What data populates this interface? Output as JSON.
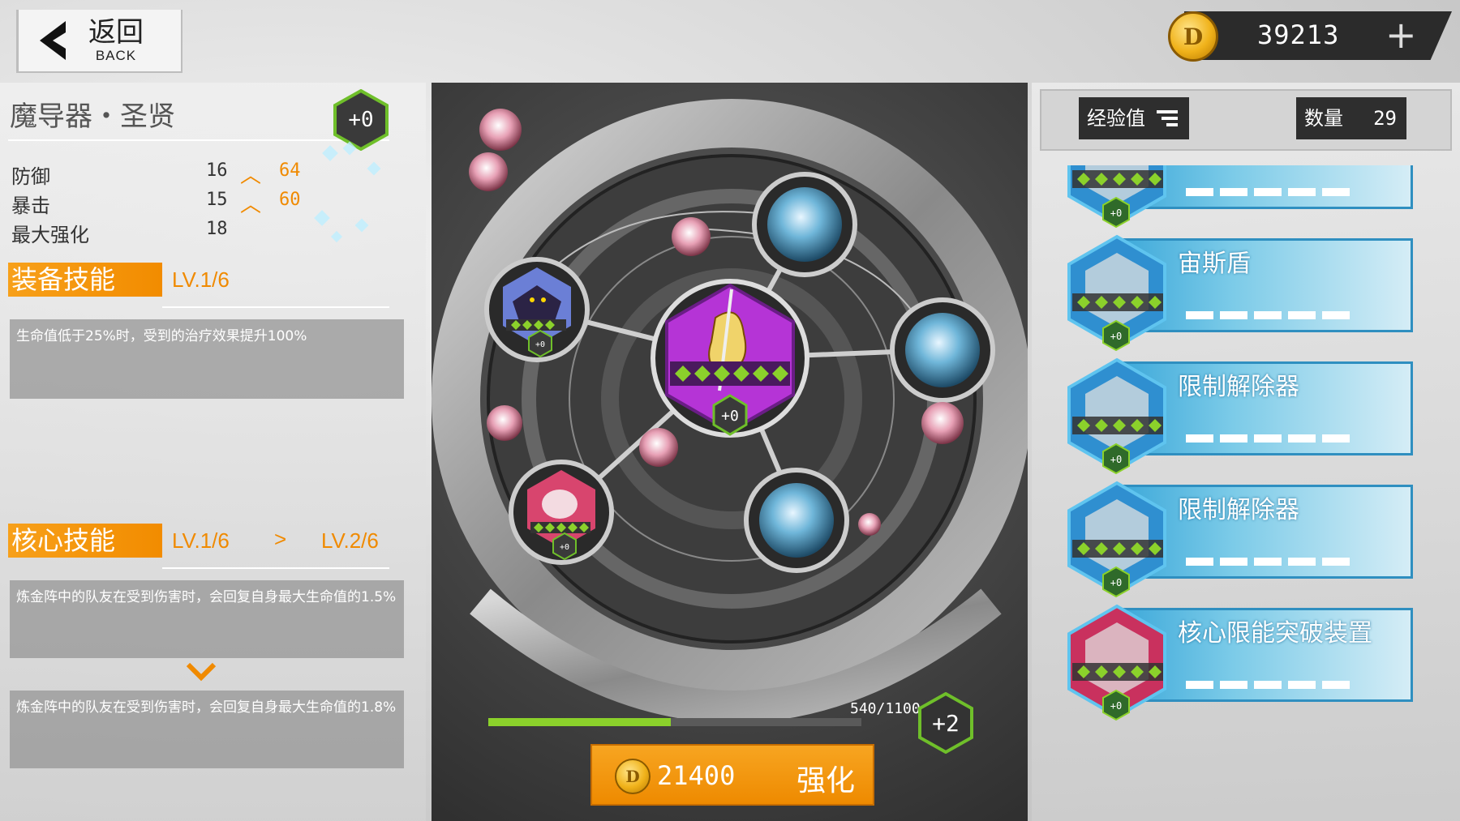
{
  "header": {
    "back_cn": "返回",
    "back_en": "BACK",
    "currency_amount": "39213",
    "currency_plus": "+"
  },
  "equipment": {
    "name": "魔导器・圣贤",
    "level_badge": "+0",
    "stats": [
      {
        "label": "防御",
        "value": "16",
        "new_value": "64"
      },
      {
        "label": "暴击",
        "value": "15",
        "new_value": "60"
      },
      {
        "label": "最大强化",
        "value": "18",
        "new_value": ""
      }
    ]
  },
  "equip_skill": {
    "label": "装备技能",
    "level": "LV.1/6",
    "description": "生命值低于25%时，受到的治疗效果提升100%"
  },
  "core_skill": {
    "label": "核心技能",
    "level_current": "LV.1/6",
    "arrow": ">",
    "level_next": "LV.2/6",
    "description_current": "炼金阵中的队友在受到伤害时，会回复自身最大生命值的1.5%",
    "description_next": "炼金阵中的队友在受到伤害时，会回复自身最大生命值的1.8%"
  },
  "center": {
    "main_badge": "+0",
    "slot_badge_1": "+0",
    "slot_badge_2": "+0",
    "progress_text": "540/1100",
    "progress_fraction": 0.49,
    "gain_badge": "+2",
    "upgrade_cost": "21400",
    "upgrade_label": "强化"
  },
  "right": {
    "sort_label": "经验值",
    "count_label": "数量",
    "count_value": "29",
    "items": [
      {
        "name": "",
        "badge": "+0",
        "color": "#2f8fd0"
      },
      {
        "name": "宙斯盾",
        "badge": "+0",
        "color": "#2f8fd0"
      },
      {
        "name": "限制解除器",
        "badge": "+0",
        "color": "#2f8fd0"
      },
      {
        "name": "限制解除器",
        "badge": "+0",
        "color": "#2f8fd0"
      },
      {
        "name": "核心限能突破装置",
        "badge": "+0",
        "color": "#c9315e"
      }
    ]
  },
  "colors": {
    "accent": "#f08a00",
    "progress": "#8bd12b",
    "badge_green": "#6fbf2a",
    "main_purple": "#b534d6"
  }
}
